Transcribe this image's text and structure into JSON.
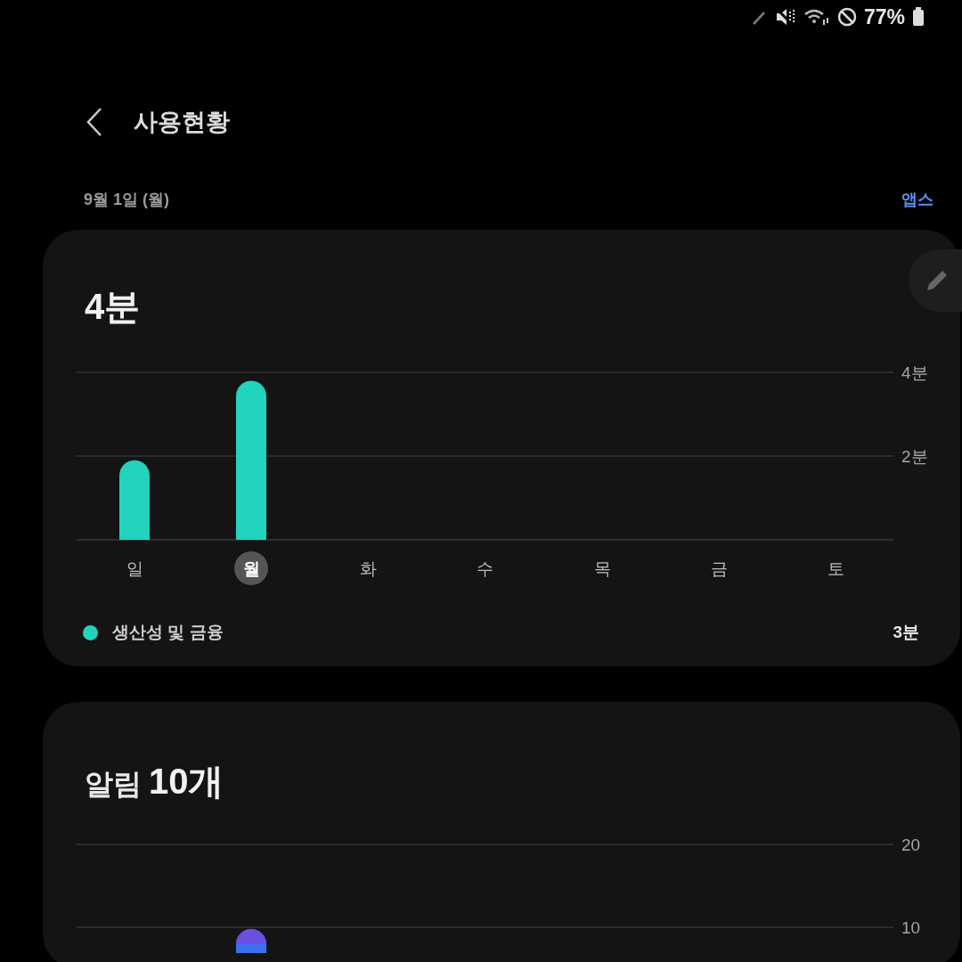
{
  "status_bar": {
    "battery": "77%"
  },
  "header": {
    "title": "사용현황",
    "date": "9월 1일 (월)",
    "apps_link": "앱스"
  },
  "usage_card": {
    "total": "4분",
    "chart_data": {
      "type": "bar",
      "categories": [
        "일",
        "월",
        "화",
        "수",
        "목",
        "금",
        "토"
      ],
      "yticks": [
        {
          "value": 2,
          "label": "2분"
        },
        {
          "value": 4,
          "label": "4분"
        }
      ],
      "ylim": [
        0,
        4
      ],
      "series": [
        {
          "name": "생산성 및 금융",
          "color": "#22d3bd",
          "values": [
            1.9,
            3.8,
            null,
            null,
            null,
            null,
            null
          ]
        }
      ]
    },
    "days": [
      {
        "selected": false
      },
      {
        "selected": true
      },
      {
        "selected": false
      },
      {
        "selected": false
      },
      {
        "selected": false
      },
      {
        "selected": false
      },
      {
        "selected": false
      }
    ],
    "legend_value": "3분"
  },
  "notifications_card": {
    "label": "알림",
    "count": "10개",
    "axis_labels": [
      "20",
      "10"
    ]
  }
}
